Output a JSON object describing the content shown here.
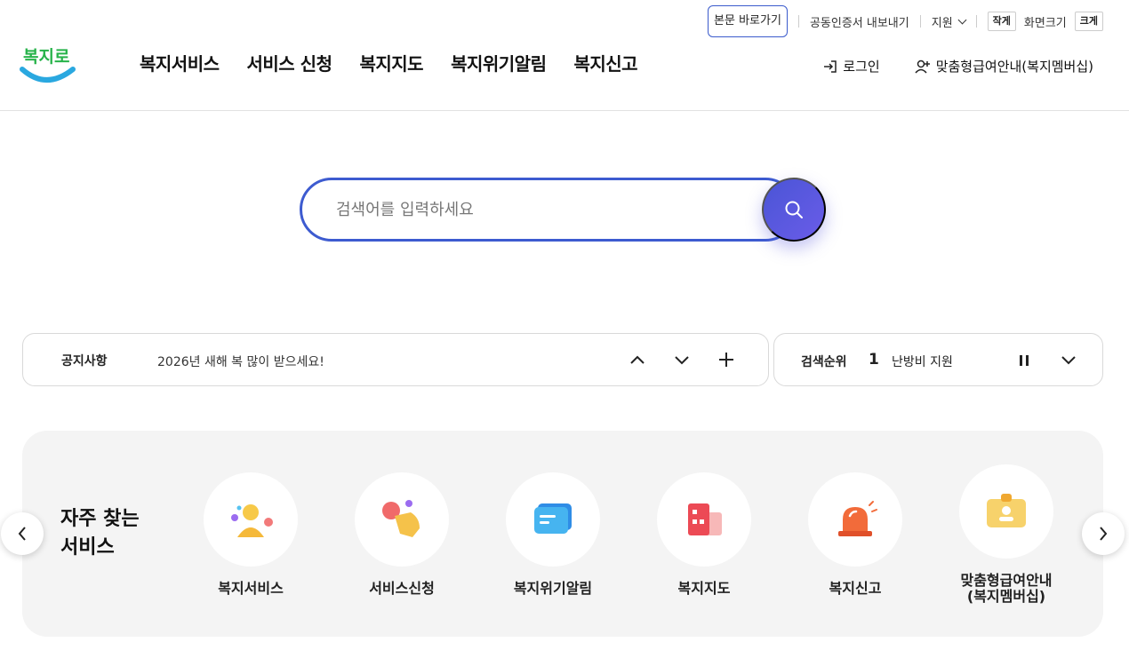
{
  "utility": {
    "skip_link": "본문 바로가기",
    "cert_export": "공동인증서 내보내기",
    "support": "지원",
    "font_small": "작게",
    "font_label": "화면크기",
    "font_large": "크게"
  },
  "logo": {
    "text": "복지로",
    "brand_color": "#2aa8e0"
  },
  "nav": [
    {
      "label": "복지서비스"
    },
    {
      "label": "서비스 신청"
    },
    {
      "label": "복지지도"
    },
    {
      "label": "복지위기알림"
    },
    {
      "label": "복지신고"
    }
  ],
  "header_right": {
    "login": "로그인",
    "membership": "맞춤형급여안내(복지멤버십)"
  },
  "search": {
    "placeholder": "검색어를 입력하세요",
    "button_color": "#5657dc",
    "border_color": "#3d5bd0"
  },
  "notice": {
    "title": "공지사항",
    "text": "2026년 새해 복 많이 받으세요!"
  },
  "ranking": {
    "title": "검색순위",
    "rank": "1",
    "keyword": "난방비 지원"
  },
  "favorites": {
    "title": "자주 찾는\n서비스",
    "items": [
      {
        "label": "복지서비스",
        "icon": "person-icon"
      },
      {
        "label": "서비스신청",
        "icon": "hand-touch-icon"
      },
      {
        "label": "복지위기알림",
        "icon": "message-icon"
      },
      {
        "label": "복지지도",
        "icon": "building-map-icon"
      },
      {
        "label": "복지신고",
        "icon": "siren-icon"
      },
      {
        "label": "맞춤형급여안내\n(복지멤버십)",
        "icon": "membership-card-icon"
      }
    ]
  }
}
